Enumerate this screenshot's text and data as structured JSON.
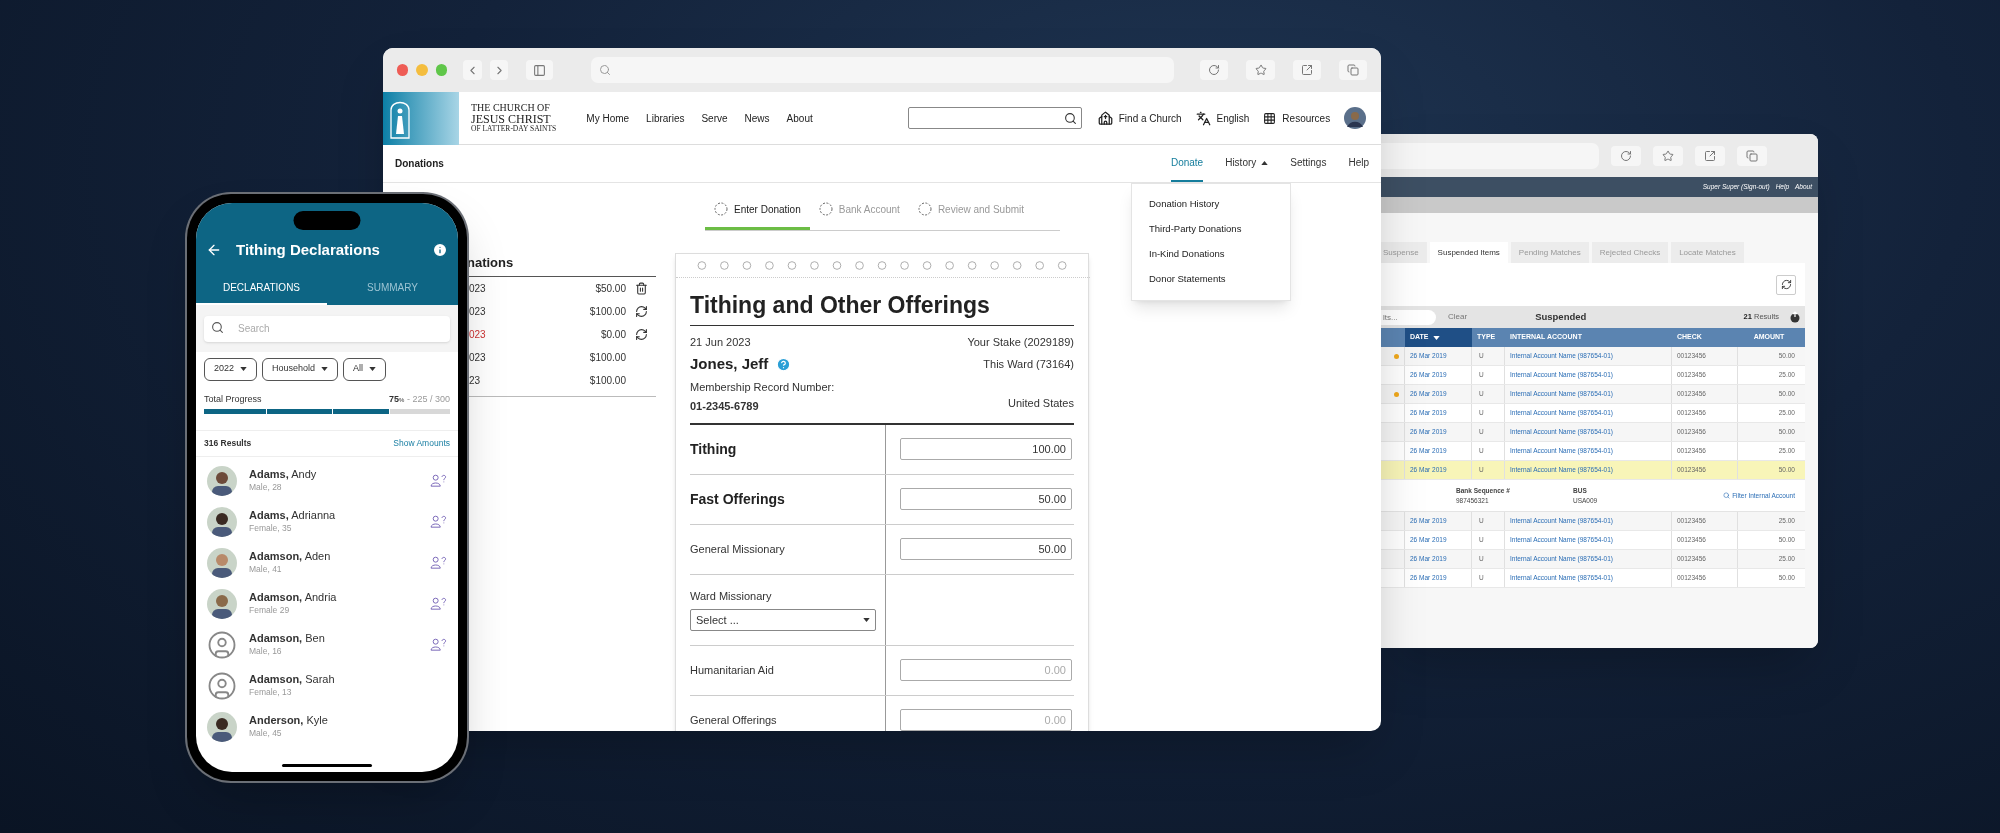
{
  "main_browser": {
    "site_header": {
      "logo_lines": [
        "THE CHURCH OF",
        "JESUS CHRIST",
        "OF LATTER-DAY SAINTS"
      ],
      "nav": [
        "My Home",
        "Libraries",
        "Serve",
        "News",
        "About"
      ],
      "links": [
        {
          "kind": "church",
          "label": "Find a Church"
        },
        {
          "kind": "language",
          "label": "English"
        },
        {
          "kind": "grid",
          "label": "Resources"
        }
      ]
    },
    "subnav": {
      "title": "Donations",
      "items": [
        {
          "label": "Donate",
          "kind": "link",
          "selected": true
        },
        {
          "label": "History",
          "kind": "menu",
          "selected": false
        },
        {
          "label": "Settings",
          "kind": "link",
          "selected": false
        },
        {
          "label": "Help",
          "kind": "link",
          "selected": false
        }
      ]
    },
    "history_menu": [
      "Donation History",
      "Third-Party Donations",
      "In-Kind Donations",
      "Donor Statements"
    ],
    "steps": [
      {
        "label": "Enter Donation",
        "selected": true
      },
      {
        "label": "Bank Account",
        "selected": false
      },
      {
        "label": "Review and Submit",
        "selected": false
      }
    ],
    "donations_list": {
      "heading": "nations",
      "rows": [
        {
          "kind": "delete",
          "date": "023",
          "amount": "$50.00",
          "error": false
        },
        {
          "kind": "recurring",
          "date": "023",
          "amount": "$100.00",
          "error": false
        },
        {
          "kind": "recurring",
          "date": "023",
          "amount": "$0.00",
          "error": true
        },
        {
          "kind": "plain",
          "date": "023",
          "amount": "$100.00",
          "error": false
        },
        {
          "kind": "plain",
          "date": "23",
          "amount": "$100.00",
          "error": false
        }
      ]
    },
    "form": {
      "title": "Tithing and Other Offerings",
      "date": "21 Jun 2023",
      "name": "Jones, Jeff",
      "record_label": "Membership Record Number:",
      "record_number": "01-2345-6789",
      "stake": "Your Stake (2029189)",
      "ward": "This Ward (73164)",
      "country": "United States",
      "rows": [
        {
          "kind": "amount",
          "label": "Tithing",
          "bold": true,
          "value": "100.00"
        },
        {
          "kind": "amount",
          "label": "Fast Offerings",
          "bold": true,
          "value": "50.00"
        },
        {
          "kind": "amount",
          "label": "General Missionary",
          "bold": false,
          "value": "50.00"
        },
        {
          "kind": "select",
          "label": "Ward Missionary",
          "bold": false,
          "value": "Select ..."
        },
        {
          "kind": "amount",
          "label": "Humanitarian Aid",
          "bold": false,
          "placeholder": "0.00"
        },
        {
          "kind": "amount",
          "label": "General Offerings",
          "bold": false,
          "placeholder": "0.00"
        }
      ]
    }
  },
  "back_browser": {
    "header_links": [
      "Super Super (Sign-out)",
      "Help",
      "About"
    ],
    "tabs": [
      {
        "label": "Suspense",
        "selected": false
      },
      {
        "label": "Suspended Items",
        "selected": true
      },
      {
        "label": "Pending Matches",
        "selected": false
      },
      {
        "label": "Rejected Checks",
        "selected": false
      },
      {
        "label": "Locate Matches",
        "selected": false
      }
    ],
    "toolbar": {
      "search_placeholder": "lts...",
      "clear": "Clear",
      "title": "Suspended",
      "results_count": "21",
      "results_label": "Results"
    },
    "table": {
      "columns": [
        {
          "label": "DATE",
          "sorted": true
        },
        {
          "label": "TYPE",
          "sorted": false
        },
        {
          "label": "INTERNAL ACCOUNT",
          "sorted": false
        },
        {
          "label": "CHECK",
          "sorted": false
        },
        {
          "label": "AMOUNT",
          "sorted": false
        }
      ],
      "rows": [
        {
          "kind": "data",
          "flagged": true,
          "highlighted": false,
          "date": "26 Mar 2019",
          "type": "U",
          "account": "Internal Account Name (987654-01)",
          "check": "00123456",
          "amount": "50.00"
        },
        {
          "kind": "data",
          "flagged": false,
          "highlighted": false,
          "date": "26 Mar 2019",
          "type": "U",
          "account": "Internal Account Name (987654-01)",
          "check": "00123456",
          "amount": "25.00"
        },
        {
          "kind": "data",
          "flagged": true,
          "highlighted": false,
          "date": "26 Mar 2019",
          "type": "U",
          "account": "Internal Account Name (987654-01)",
          "check": "00123456",
          "amount": "50.00"
        },
        {
          "kind": "data",
          "flagged": false,
          "highlighted": false,
          "date": "26 Mar 2019",
          "type": "U",
          "account": "Internal Account Name (987654-01)",
          "check": "00123456",
          "amount": "25.00"
        },
        {
          "kind": "data",
          "flagged": false,
          "highlighted": false,
          "date": "26 Mar 2019",
          "type": "U",
          "account": "Internal Account Name (987654-01)",
          "check": "00123456",
          "amount": "50.00"
        },
        {
          "kind": "data",
          "flagged": false,
          "highlighted": false,
          "date": "26 Mar 2019",
          "type": "U",
          "account": "Internal Account Name (987654-01)",
          "check": "00123456",
          "amount": "25.00"
        },
        {
          "kind": "data",
          "flagged": false,
          "highlighted": true,
          "date": "26 Mar 2019",
          "type": "U",
          "account": "Internal Account Name (987654-01)",
          "check": "00123456",
          "amount": "50.00"
        },
        {
          "kind": "detail",
          "seq_label": "Bank Sequence #",
          "seq_value": "987456321",
          "bus_label": "BUS",
          "bus_value": "USA009",
          "link": "Filter Internal Account"
        },
        {
          "kind": "data",
          "flagged": false,
          "highlighted": false,
          "date": "26 Mar 2019",
          "type": "U",
          "account": "Internal Account Name (987654-01)",
          "check": "00123456",
          "amount": "25.00"
        },
        {
          "kind": "data",
          "flagged": false,
          "highlighted": false,
          "date": "26 Mar 2019",
          "type": "U",
          "account": "Internal Account Name (987654-01)",
          "check": "00123456",
          "amount": "50.00"
        },
        {
          "kind": "data",
          "flagged": false,
          "highlighted": false,
          "date": "26 Mar 2019",
          "type": "U",
          "account": "Internal Account Name (987654-01)",
          "check": "00123456",
          "amount": "25.00"
        },
        {
          "kind": "data",
          "flagged": false,
          "highlighted": false,
          "date": "26 Mar 2019",
          "type": "U",
          "account": "Internal Account Name (987654-01)",
          "check": "00123456",
          "amount": "50.00"
        }
      ]
    }
  },
  "phone": {
    "title": "Tithing Declarations",
    "tabs": [
      {
        "label": "DECLARATIONS",
        "selected": true
      },
      {
        "label": "SUMMARY",
        "selected": false
      }
    ],
    "search": {
      "placeholder": "Search"
    },
    "filters": [
      "2022",
      "Household",
      "All"
    ],
    "progress": {
      "label": "Total Progress",
      "percent": "75",
      "unit": "%",
      "count": "- 225 / 300",
      "level": 0.75
    },
    "results": "316 Results",
    "show_amounts": "Show Amounts",
    "people": [
      {
        "kind": "photo",
        "last": "Adams,",
        "first": "Andy",
        "detail": "Male, 28",
        "unverified": true
      },
      {
        "kind": "photo",
        "last": "Adams,",
        "first": "Adrianna",
        "detail": "Female, 35",
        "unverified": true
      },
      {
        "kind": "photo",
        "last": "Adamson,",
        "first": "Aden",
        "detail": "Male, 41",
        "unverified": true
      },
      {
        "kind": "photo",
        "last": "Adamson,",
        "first": "Andria",
        "detail": "Female 29",
        "unverified": true
      },
      {
        "kind": "placeholder",
        "last": "Adamson,",
        "first": "Ben",
        "detail": "Male, 16",
        "unverified": true
      },
      {
        "kind": "placeholder",
        "last": "Adamson,",
        "first": "Sarah",
        "detail": "Female, 13",
        "unverified": false
      },
      {
        "kind": "photo",
        "last": "Anderson,",
        "first": "Kyle",
        "detail": "Male, 45",
        "unverified": false
      }
    ]
  }
}
